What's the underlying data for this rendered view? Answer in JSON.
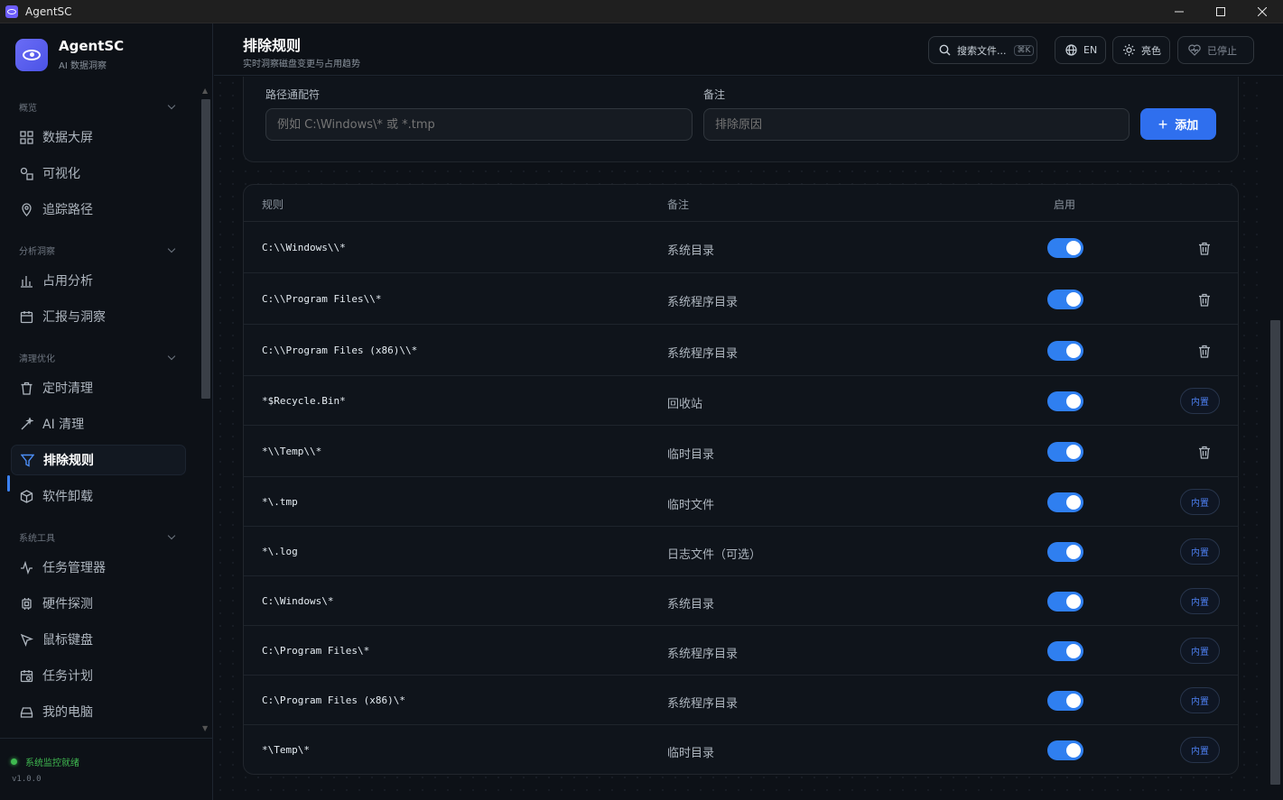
{
  "window": {
    "title": "AgentSC"
  },
  "brand": {
    "name": "AgentSC",
    "subtitle": "AI 数据洞察"
  },
  "nav": {
    "sections": [
      {
        "label": "概览",
        "items": [
          "数据大屏",
          "可视化",
          "追踪路径"
        ]
      },
      {
        "label": "分析洞察",
        "items": [
          "占用分析",
          "汇报与洞察"
        ]
      },
      {
        "label": "清理优化",
        "items": [
          "定时清理",
          "AI 清理",
          "排除规则",
          "软件卸载"
        ]
      },
      {
        "label": "系统工具",
        "items": [
          "任务管理器",
          "硬件探测",
          "鼠标键盘",
          "任务计划",
          "我的电脑"
        ]
      }
    ],
    "active": "排除规则"
  },
  "footer": {
    "status": "系统监控就绪",
    "version": "v1.0.0"
  },
  "header": {
    "title": "排除规则",
    "subtitle": "实时洞察磁盘变更与占用趋势",
    "search_label": "搜索文件...",
    "search_shortcut": "⌘K",
    "lang_label": "EN",
    "theme_label": "亮色",
    "stopped_label": "已停止"
  },
  "form": {
    "pattern_label": "路径通配符",
    "pattern_placeholder": "例如 C:\\Windows\\* 或 *.tmp",
    "note_label": "备注",
    "note_placeholder": "排除原因",
    "add_label": "添加"
  },
  "table": {
    "columns": [
      "规则",
      "备注",
      "启用"
    ],
    "builtin_label": "内置",
    "rows": [
      {
        "rule": "C:\\\\Windows\\\\*",
        "note": "系统目录",
        "enabled": true,
        "action": "delete"
      },
      {
        "rule": "C:\\\\Program Files\\\\*",
        "note": "系统程序目录",
        "enabled": true,
        "action": "delete"
      },
      {
        "rule": "C:\\\\Program Files (x86)\\\\*",
        "note": "系统程序目录",
        "enabled": true,
        "action": "delete"
      },
      {
        "rule": "*$Recycle.Bin*",
        "note": "回收站",
        "enabled": true,
        "action": "builtin"
      },
      {
        "rule": "*\\\\Temp\\\\*",
        "note": "临时目录",
        "enabled": true,
        "action": "delete"
      },
      {
        "rule": "*\\.tmp",
        "note": "临时文件",
        "enabled": true,
        "action": "builtin"
      },
      {
        "rule": "*\\.log",
        "note": "日志文件（可选）",
        "enabled": true,
        "action": "builtin"
      },
      {
        "rule": "C:\\Windows\\*",
        "note": "系统目录",
        "enabled": true,
        "action": "builtin"
      },
      {
        "rule": "C:\\Program Files\\*",
        "note": "系统程序目录",
        "enabled": true,
        "action": "builtin"
      },
      {
        "rule": "C:\\Program Files (x86)\\*",
        "note": "系统程序目录",
        "enabled": true,
        "action": "builtin"
      },
      {
        "rule": "*\\Temp\\*",
        "note": "临时目录",
        "enabled": true,
        "action": "builtin"
      }
    ]
  },
  "colors": {
    "accent": "#2f7ff0",
    "status_ok": "#3fb950",
    "background": "#0d1117"
  }
}
